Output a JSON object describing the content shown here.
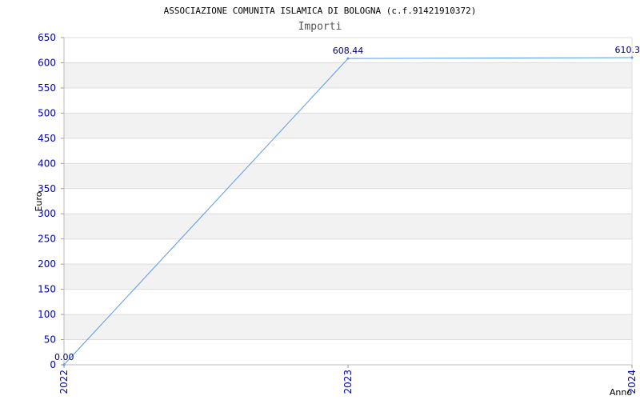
{
  "chart_data": {
    "type": "line",
    "title": "ASSOCIAZIONE COMUNITA ISLAMICA DI BOLOGNA (c.f.91421910372)",
    "subtitle": "Importi",
    "xlabel": "Anno",
    "ylabel": "Euro",
    "categories": [
      "2022",
      "2023",
      "2024"
    ],
    "series": [
      {
        "values": [
          0.0,
          608.44,
          610.3
        ],
        "labels": [
          "0.00",
          "608.44",
          "610.3"
        ]
      }
    ],
    "ylim": [
      0,
      650
    ],
    "yticks": [
      0,
      50,
      100,
      150,
      200,
      250,
      300,
      350,
      400,
      450,
      500,
      550,
      600,
      650
    ],
    "grid": true,
    "colors": {
      "line": "#5599ee",
      "band": "#f2f2f2",
      "grid": "#dddddd",
      "ticks": "#0000c0",
      "labels": "#000080"
    }
  }
}
